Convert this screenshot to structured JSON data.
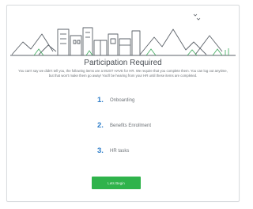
{
  "dialog": {
    "title": "Participation Required",
    "description": "You can't say we didn't tell you, the following items are a MUST HAVE for HR. We require that you complete them. You can log out anytime, but that won't make them go away! You'll be hearing from your HR until these items are completed.",
    "steps": [
      {
        "number": "1.",
        "label": "Onboarding"
      },
      {
        "number": "2.",
        "label": "Benefits Enrollment"
      },
      {
        "number": "3.",
        "label": "HR tasks"
      }
    ],
    "button_label": "Lets Begin"
  },
  "colors": {
    "accent_blue": "#2f7ec9",
    "button_green": "#2fb34b",
    "illustration_gray": "#5b6168",
    "illustration_green": "#4db06a"
  },
  "icons": {
    "banner": "city-skyline-illustration"
  }
}
